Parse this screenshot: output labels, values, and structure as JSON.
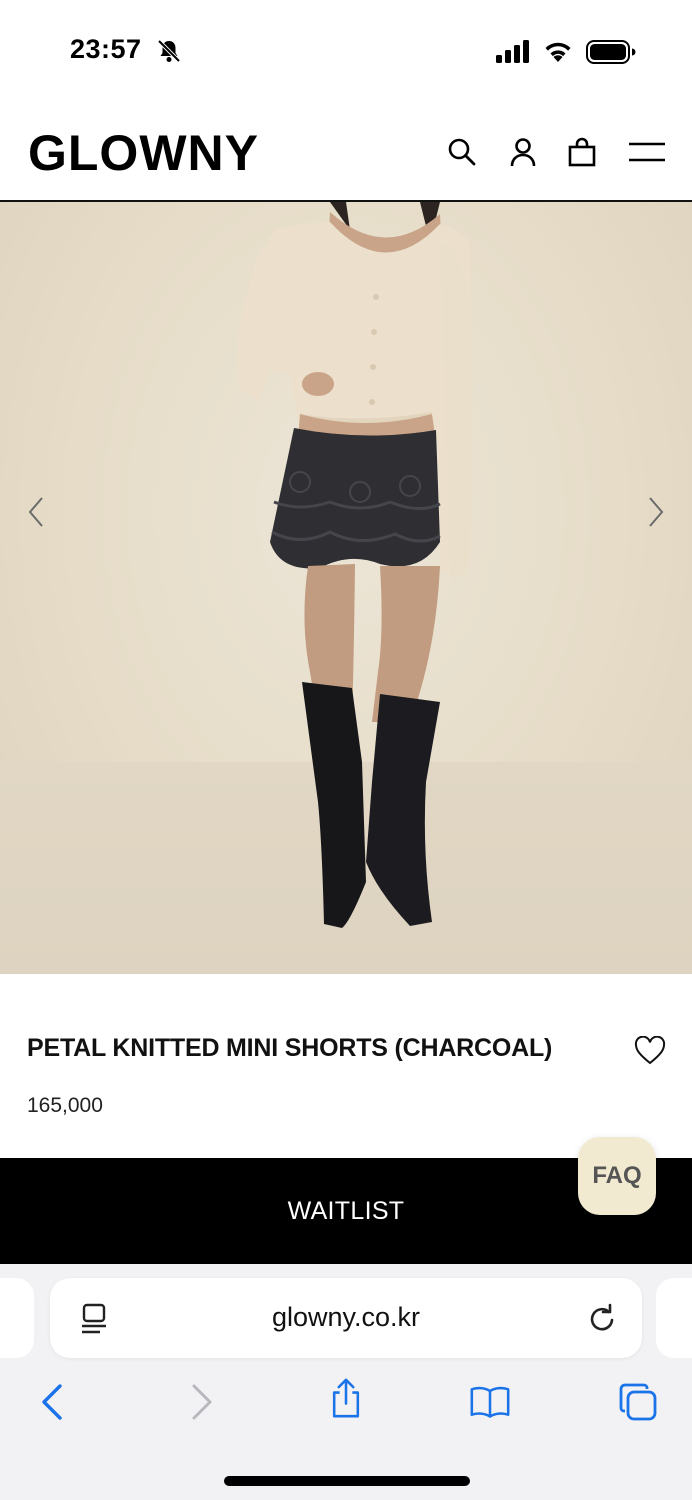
{
  "status_bar": {
    "time": "23:57",
    "icons": [
      "bell-slash-icon",
      "cellular-signal-icon",
      "wifi-icon",
      "battery-icon"
    ]
  },
  "header": {
    "logo": "GLOWNY",
    "icons": [
      "search-icon",
      "account-icon",
      "shopping-bag-icon",
      "menu-icon"
    ]
  },
  "product": {
    "title": "PETAL KNITTED MINI SHORTS (CHARCOAL)",
    "price": "165,000",
    "gallery_nav": [
      "chevron-left-icon",
      "chevron-right-icon"
    ]
  },
  "actions": {
    "waitlist_label": "WAITLIST",
    "faq_label": "FAQ"
  },
  "browser": {
    "url": "glowny.co.kr",
    "toolbar": [
      "back-icon",
      "forward-icon",
      "share-icon",
      "bookmarks-icon",
      "tabs-icon"
    ]
  },
  "colors": {
    "primary": "#000000",
    "background": "#ffffff",
    "faq_bg": "#f2ead0",
    "browser_bg": "#f2f2f4",
    "link_blue": "#1a73e8"
  }
}
